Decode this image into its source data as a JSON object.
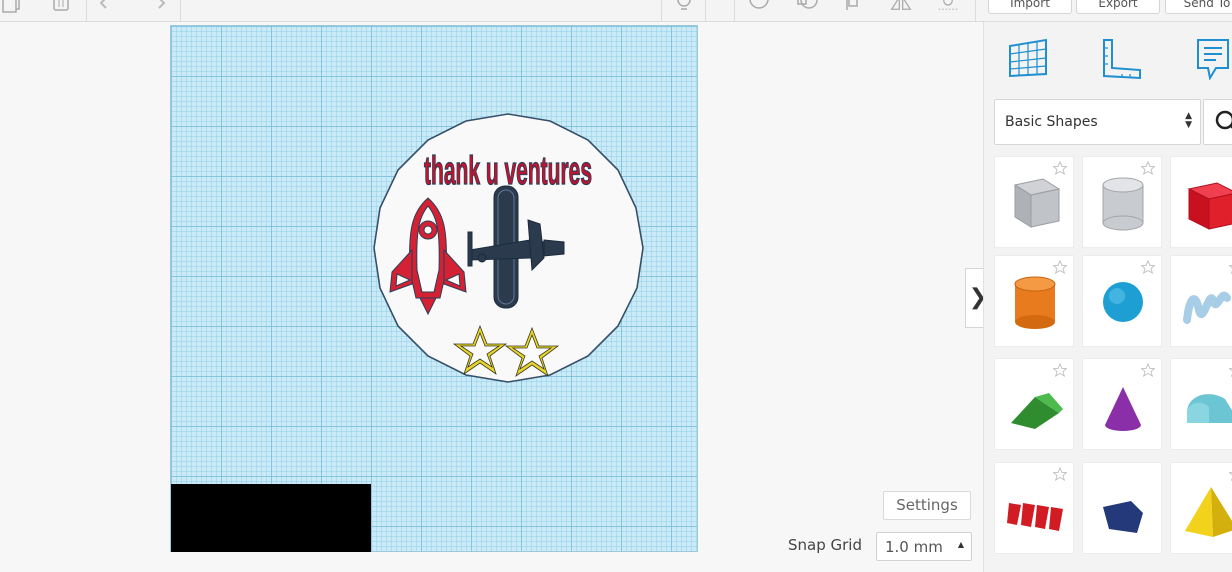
{
  "toolbar": {
    "import_label": "Import",
    "export_label": "Export",
    "send_label": "Send To"
  },
  "design": {
    "title_text": "thank u ventures"
  },
  "workplane": {
    "settings_label": "Settings",
    "snap_grid_label": "Snap Grid",
    "snap_grid_value": "1.0 mm"
  },
  "panel": {
    "collapse_glyph": "❯",
    "shapes_category": "Basic Shapes",
    "icons": [
      "workplane-icon",
      "ruler-icon",
      "notes-icon",
      "search-icon"
    ],
    "shapes": [
      {
        "name": "box",
        "color": "#b9bcc2"
      },
      {
        "name": "cylinder-hole",
        "color": "#c3c6cc"
      },
      {
        "name": "box",
        "color": "#e0202a"
      },
      {
        "name": "cylinder",
        "color": "#e87b1e"
      },
      {
        "name": "sphere",
        "color": "#1e9fd4"
      },
      {
        "name": "scribble",
        "color": "#a8cde6"
      },
      {
        "name": "roof",
        "color": "#38a538"
      },
      {
        "name": "cone",
        "color": "#8a2fa8"
      },
      {
        "name": "round-roof",
        "color": "#6cc5d2"
      },
      {
        "name": "text",
        "color": "#d21c24"
      },
      {
        "name": "polygon",
        "color": "#24397a"
      },
      {
        "name": "pyramid",
        "color": "#f2d21c"
      }
    ]
  }
}
